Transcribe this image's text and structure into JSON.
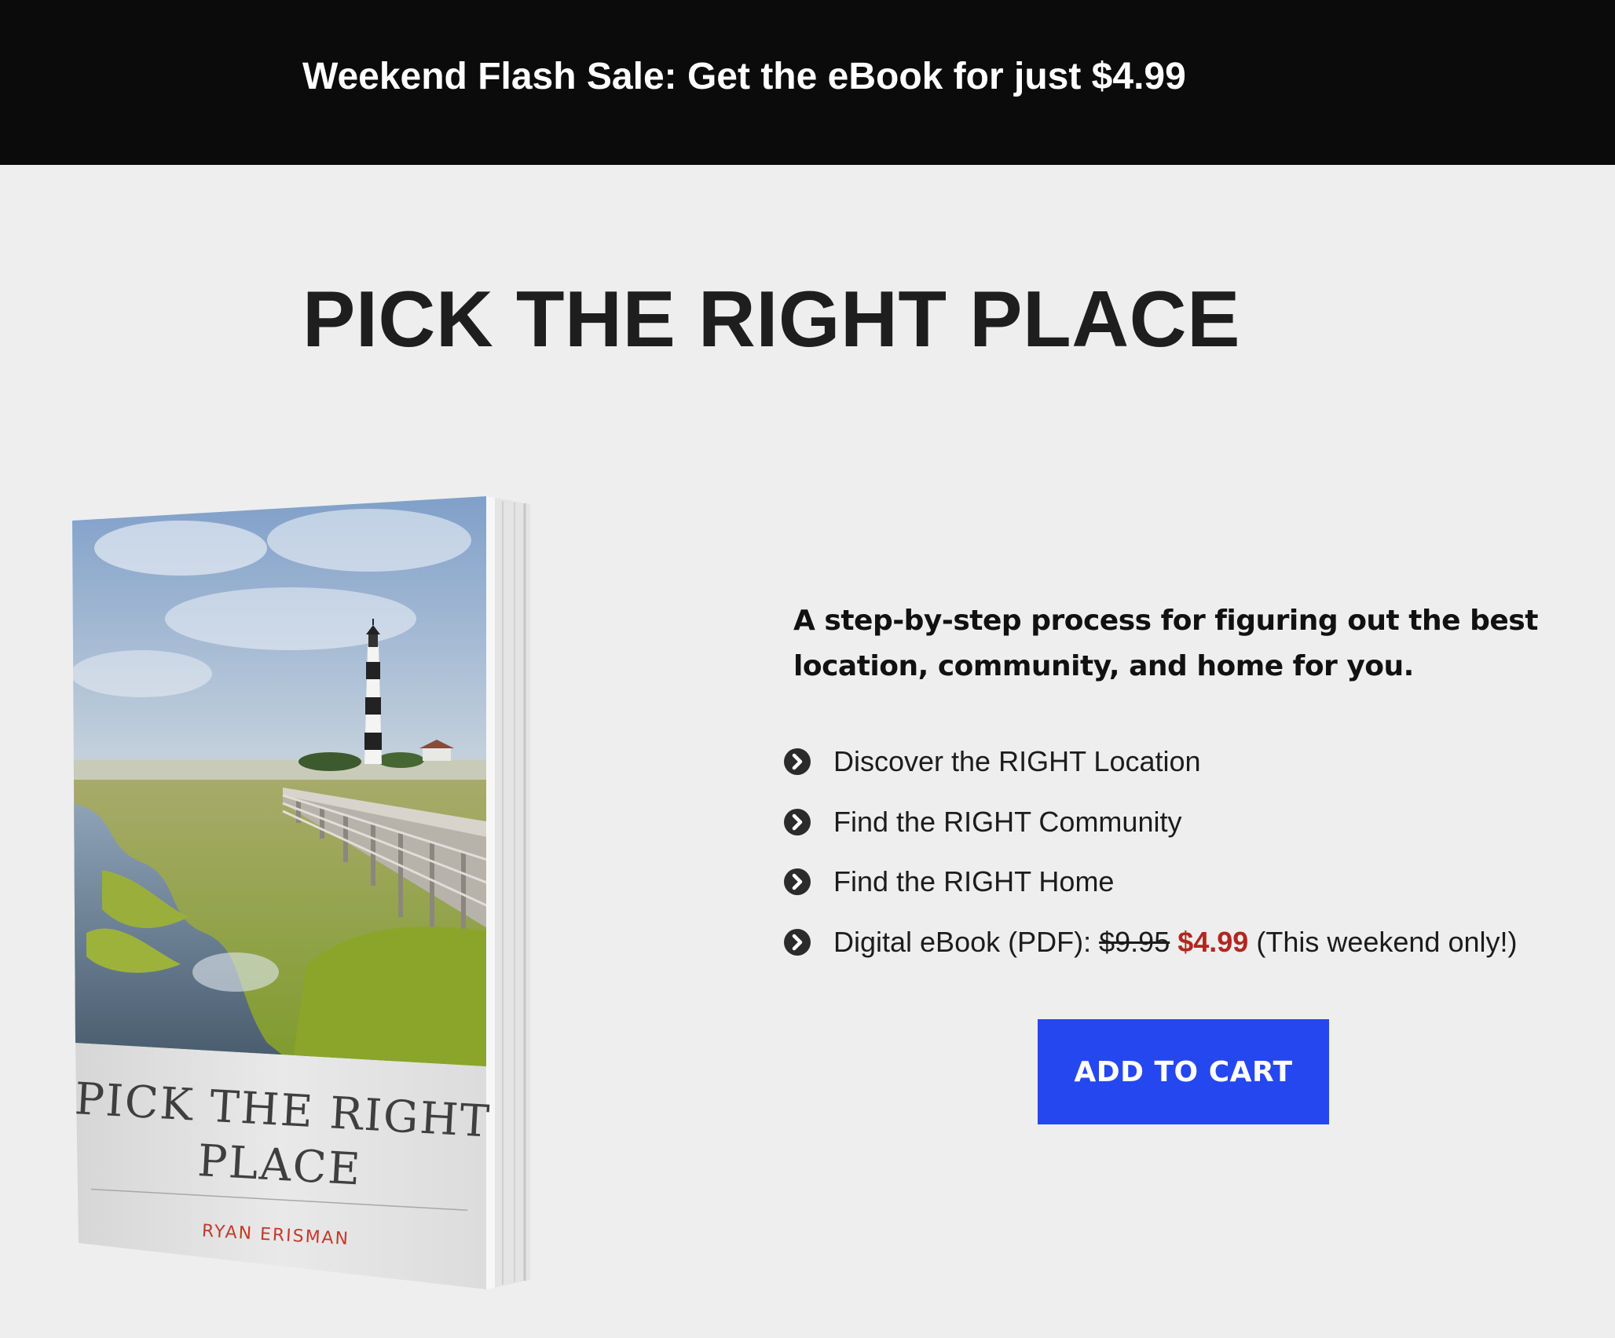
{
  "promo_bar": {
    "text": "Weekend Flash Sale: Get the eBook for just $4.99"
  },
  "page_title": "PICK THE RIGHT PLACE",
  "book": {
    "cover_title_line1": "PICK THE RIGHT",
    "cover_title_line2": "PLACE",
    "cover_author": "RYAN ERISMAN"
  },
  "tagline": "A step-by-step process for figuring out the best location, community, and home for you.",
  "features": [
    {
      "label": "Discover the RIGHT Location",
      "icon": "chevron-circle-right-icon"
    },
    {
      "label": "Find the RIGHT Community",
      "icon": "chevron-circle-right-icon"
    },
    {
      "label": "Find the RIGHT Home",
      "icon": "chevron-circle-right-icon"
    }
  ],
  "price_item": {
    "icon": "chevron-circle-right-icon",
    "label": "Digital eBook (PDF):",
    "old_price": "$9.95",
    "new_price": "$4.99",
    "note": "(This weekend only!)"
  },
  "cta": {
    "label": "ADD TO CART"
  },
  "colors": {
    "promo_bar_bg": "#0b0b0b",
    "page_bg": "#eeeeee",
    "button_bg": "#2547f0",
    "sale_price": "#b3261e",
    "author_name": "#c23a2b"
  }
}
